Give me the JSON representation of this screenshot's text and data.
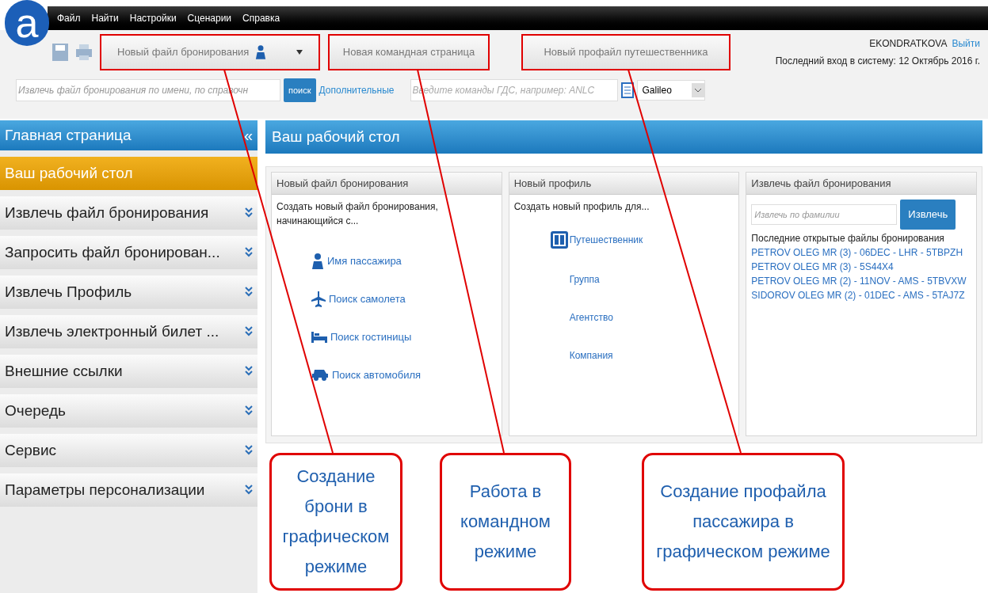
{
  "logo": "a",
  "menu": [
    "Файл",
    "Найти",
    "Настройки",
    "Сценарии",
    "Справка"
  ],
  "toolbar": [
    {
      "label": "Новый файл бронирования",
      "kind": "split"
    },
    {
      "label": "Новая командная страница",
      "kind": "plain"
    },
    {
      "label": "Новый профайл путешественника",
      "kind": "plain"
    }
  ],
  "user": {
    "name": "EKONDRATKOVA",
    "logout": "Выйти",
    "last_login": "Последний вход в систему: 12 Октябрь 2016 г."
  },
  "search": {
    "placeholder": "Извлечь файл бронирования по имени, по справочн",
    "button": "поиск",
    "more": "Дополнительные"
  },
  "command": {
    "placeholder": "Введите команды ГДС, например: ANLC",
    "system": "Galileo"
  },
  "sidebar": {
    "title": "Главная страница",
    "collapse": "«",
    "items": [
      {
        "label": "Ваш рабочий стол",
        "selected": true
      },
      {
        "label": "Извлечь файл бронирования",
        "selected": false
      },
      {
        "label": "Запросить файл бронирован...",
        "selected": false
      },
      {
        "label": "Извлечь Профиль",
        "selected": false
      },
      {
        "label": "Извлечь электронный билет ...",
        "selected": false
      },
      {
        "label": "Внешние ссылки",
        "selected": false
      },
      {
        "label": "Очередь",
        "selected": false
      },
      {
        "label": "Сервис",
        "selected": false
      },
      {
        "label": "Параметры персонализации",
        "selected": false
      }
    ]
  },
  "main_title": "Ваш рабочий стол",
  "booking_panel": {
    "title": "Новый файл бронирования",
    "intro": "Создать новый файл бронирования, начинающийся с...",
    "links": [
      {
        "label": "Имя пассажира",
        "kind": "person"
      },
      {
        "label": "Поиск самолета",
        "kind": "plane"
      },
      {
        "label": "Поиск гостиницы",
        "kind": "bed"
      },
      {
        "label": "Поиск автомобиля",
        "kind": "car"
      }
    ]
  },
  "profile_panel": {
    "title": "Новый профиль",
    "intro": "Создать новый профиль для...",
    "links": [
      {
        "label": "Путешественник",
        "kind": "traveler"
      },
      {
        "label": "Группа",
        "kind": "plain"
      },
      {
        "label": "Агентство",
        "kind": "plain"
      },
      {
        "label": "Компания",
        "kind": "plain"
      }
    ]
  },
  "retrieve_panel": {
    "title": "Извлечь файл бронирования",
    "placeholder": "Извлечь по фамилии",
    "button": "Извлечь",
    "recent_title": "Последние открытые файлы бронирования",
    "recent": [
      "PETROV OLEG MR (3) - 06DEC - LHR - 5TBPZH",
      "PETROV OLEG MR (3) - 5S44X4",
      "PETROV OLEG MR (2) - 11NOV - AMS - 5TBVXW",
      "SIDOROV OLEG MR (2) - 01DEC - AMS - 5TAJ7Z"
    ]
  },
  "callouts": [
    "Создание брони в графическом режиме",
    "Работа в командном режиме",
    "Создание профайла пассажира в графическом режиме"
  ]
}
